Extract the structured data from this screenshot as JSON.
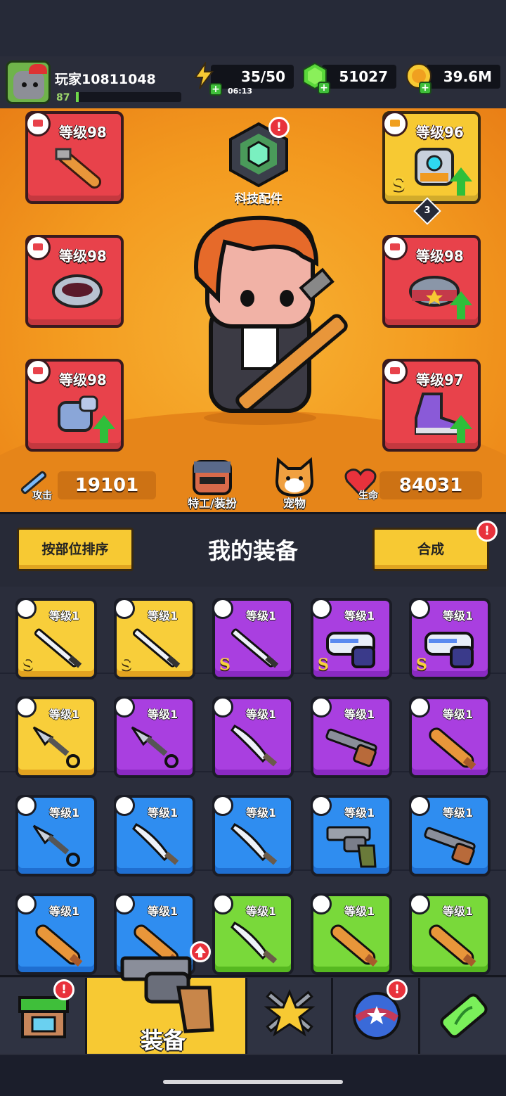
{
  "player": {
    "name": "玩家10811048",
    "level": "87",
    "xp_fraction": 0.02
  },
  "resources": {
    "energy": "35/50",
    "energy_timer": "06:13",
    "gems": "51027",
    "coins": "39.6M"
  },
  "equipment_slots": [
    {
      "id": "weapon",
      "level_label": "等级98",
      "rarity": "red",
      "upgrade": false
    },
    {
      "id": "necklace",
      "level_label": "等级98",
      "rarity": "red",
      "upgrade": false
    },
    {
      "id": "gloves",
      "level_label": "等级98",
      "rarity": "red",
      "upgrade": true
    },
    {
      "id": "armor",
      "level_label": "等级96",
      "rarity": "gold",
      "upgrade": true,
      "grade": "S",
      "stars": "3"
    },
    {
      "id": "belt",
      "level_label": "等级98",
      "rarity": "red",
      "upgrade": true
    },
    {
      "id": "boots",
      "level_label": "等级97",
      "rarity": "red",
      "upgrade": true
    }
  ],
  "tech": {
    "label": "科技配件",
    "alert": "!"
  },
  "stats": {
    "attack_label": "攻击",
    "attack_value": "19101",
    "hp_label": "生命",
    "hp_value": "84031"
  },
  "shortcuts": {
    "agent_label": "特工/装扮",
    "pet_label": "宠物"
  },
  "section": {
    "sort_button": "按部位排序",
    "title": "我的装备",
    "merge_button": "合成",
    "merge_alert": "!"
  },
  "inventory": [
    {
      "rarity": "gold",
      "item": "katana",
      "level": "等级1",
      "grade": "S"
    },
    {
      "rarity": "gold",
      "item": "katana",
      "level": "等级1",
      "grade": "S"
    },
    {
      "rarity": "purple",
      "item": "katana",
      "level": "等级1",
      "grade": "S"
    },
    {
      "rarity": "purple",
      "item": "blaster",
      "level": "等级1",
      "grade": "S"
    },
    {
      "rarity": "purple",
      "item": "blaster",
      "level": "等级1",
      "grade": "S"
    },
    {
      "rarity": "gold",
      "item": "kunai",
      "level": "等级1",
      "grade": ""
    },
    {
      "rarity": "purple",
      "item": "kunai",
      "level": "等级1",
      "grade": ""
    },
    {
      "rarity": "purple",
      "item": "scimitar",
      "level": "等级1",
      "grade": ""
    },
    {
      "rarity": "purple",
      "item": "shotgun",
      "level": "等级1",
      "grade": ""
    },
    {
      "rarity": "purple",
      "item": "club",
      "level": "等级1",
      "grade": ""
    },
    {
      "rarity": "blue",
      "item": "kunai",
      "level": "等级1",
      "grade": ""
    },
    {
      "rarity": "blue",
      "item": "scimitar",
      "level": "等级1",
      "grade": ""
    },
    {
      "rarity": "blue",
      "item": "scimitar",
      "level": "等级1",
      "grade": ""
    },
    {
      "rarity": "blue",
      "item": "revolver",
      "level": "等级1",
      "grade": ""
    },
    {
      "rarity": "blue",
      "item": "shotgun",
      "level": "等级1",
      "grade": ""
    },
    {
      "rarity": "blue",
      "item": "club",
      "level": "等级1",
      "grade": ""
    },
    {
      "rarity": "blue",
      "item": "club",
      "level": "等级1",
      "grade": ""
    },
    {
      "rarity": "green",
      "item": "scimitar",
      "level": "等级1",
      "grade": ""
    },
    {
      "rarity": "green",
      "item": "club",
      "level": "等级1",
      "grade": ""
    },
    {
      "rarity": "green",
      "item": "club",
      "level": "等级1",
      "grade": ""
    }
  ],
  "tabs": [
    {
      "id": "shop",
      "icon": "shop-icon",
      "alert": "!"
    },
    {
      "id": "equipment",
      "icon": "revolver-icon",
      "label": "装备",
      "active": true
    },
    {
      "id": "talent",
      "icon": "star-swords-icon"
    },
    {
      "id": "events",
      "icon": "globe-stars-icon",
      "alert": "!"
    },
    {
      "id": "evolve",
      "icon": "dna-capsule-icon"
    }
  ],
  "colors": {
    "gold": "#f8ce3a",
    "purple": "#a93fe0",
    "blue": "#2f8df0",
    "green": "#79d93a",
    "red": "#e8424b",
    "alert": "#e8323c"
  }
}
